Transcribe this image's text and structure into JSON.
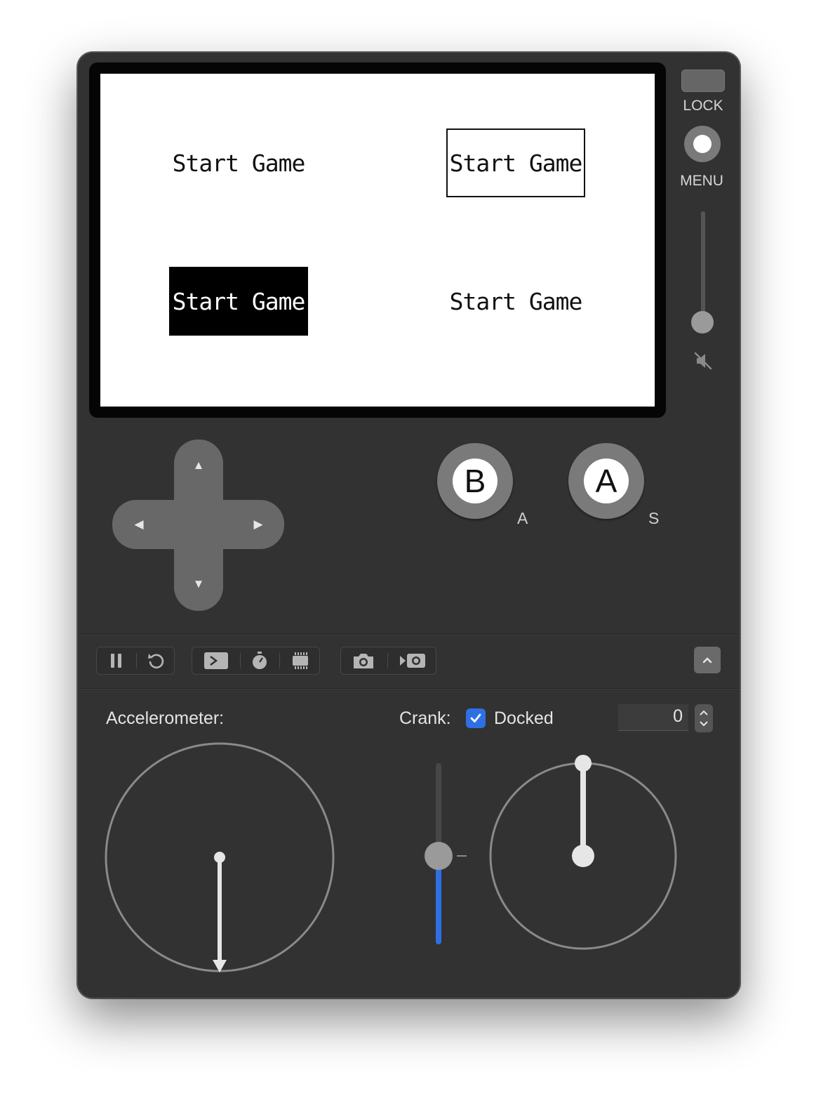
{
  "screen": {
    "buttons": [
      {
        "label": "Start Game",
        "style": "plain"
      },
      {
        "label": "Start Game",
        "style": "outlined"
      },
      {
        "label": "Start Game",
        "style": "filled"
      },
      {
        "label": "Start Game",
        "style": "plain"
      }
    ]
  },
  "side_controls": {
    "lock_label": "LOCK",
    "menu_label": "MENU",
    "volume_icon": "speaker-muted-icon"
  },
  "dpad": {
    "up": "▲",
    "down": "▼",
    "left": "◀",
    "right": "▶"
  },
  "face_buttons": {
    "b": {
      "label": "B",
      "key": "A"
    },
    "a": {
      "label": "A",
      "key": "S"
    }
  },
  "toolbar": {
    "groups": [
      [
        "pause-icon",
        "restart-icon"
      ],
      [
        "console-icon",
        "stopwatch-icon",
        "chip-icon"
      ],
      [
        "camera-icon",
        "record-video-icon"
      ]
    ],
    "collapse_icon": "chevron-up-icon"
  },
  "accelerometer": {
    "label": "Accelerometer:"
  },
  "crank": {
    "label": "Crank:",
    "docked_label": "Docked",
    "docked": true,
    "angle_value": "0"
  },
  "colors": {
    "window_bg": "#323232",
    "accent_blue": "#2f6fe4",
    "button_gray": "#686868"
  }
}
